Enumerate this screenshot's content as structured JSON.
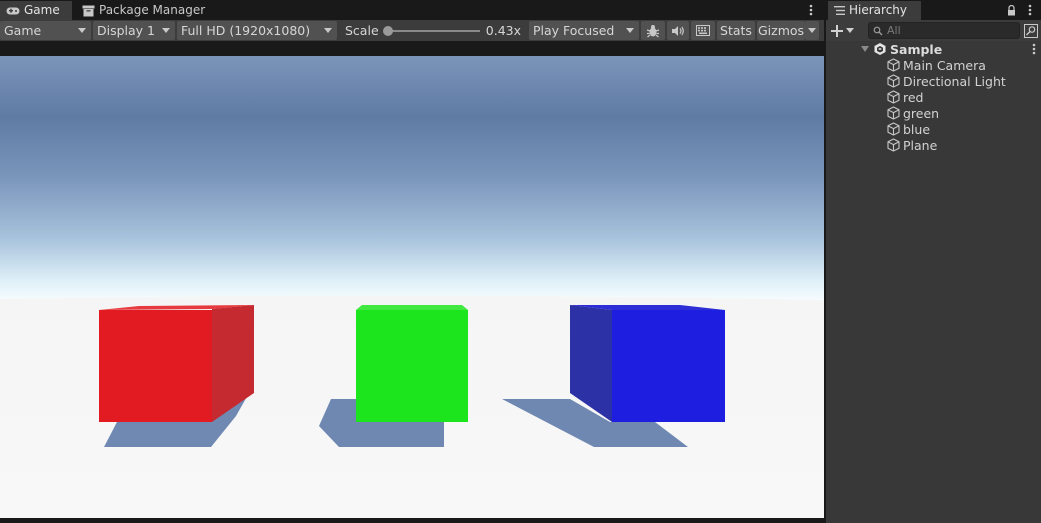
{
  "game_panel": {
    "tabs": [
      {
        "label": "Game",
        "icon": "gamepad-icon",
        "active": true
      },
      {
        "label": "Package Manager",
        "icon": "package-icon",
        "active": false
      }
    ],
    "toolbar": {
      "mode": "Game",
      "display": "Display 1",
      "resolution": "Full HD (1920x1080)",
      "scale_label": "Scale",
      "scale_value": "0.43x",
      "play_mode": "Play Focused",
      "stats_label": "Stats",
      "gizmos_label": "Gizmos"
    },
    "scene": {
      "sky_top_color": "#5f7ba4",
      "horizon_color": "#f4fbfd",
      "ground_color": "#f6f6f6",
      "cubes": [
        {
          "name": "red",
          "front_color": "#e21b22",
          "side_color": "#c42a30",
          "top_color": "#e73a3f"
        },
        {
          "name": "green",
          "front_color": "#1de51d",
          "top_color": "#40e840"
        },
        {
          "name": "blue",
          "front_color": "#1e1ee0",
          "side_color": "#2c31a6",
          "top_color": "#2e2ed6"
        }
      ]
    }
  },
  "hierarchy": {
    "tab_label": "Hierarchy",
    "search_placeholder": "All",
    "scene_name": "Sample",
    "items": [
      {
        "label": "Main Camera"
      },
      {
        "label": "Directional Light"
      },
      {
        "label": "red"
      },
      {
        "label": "green"
      },
      {
        "label": "blue"
      },
      {
        "label": "Plane"
      }
    ]
  }
}
